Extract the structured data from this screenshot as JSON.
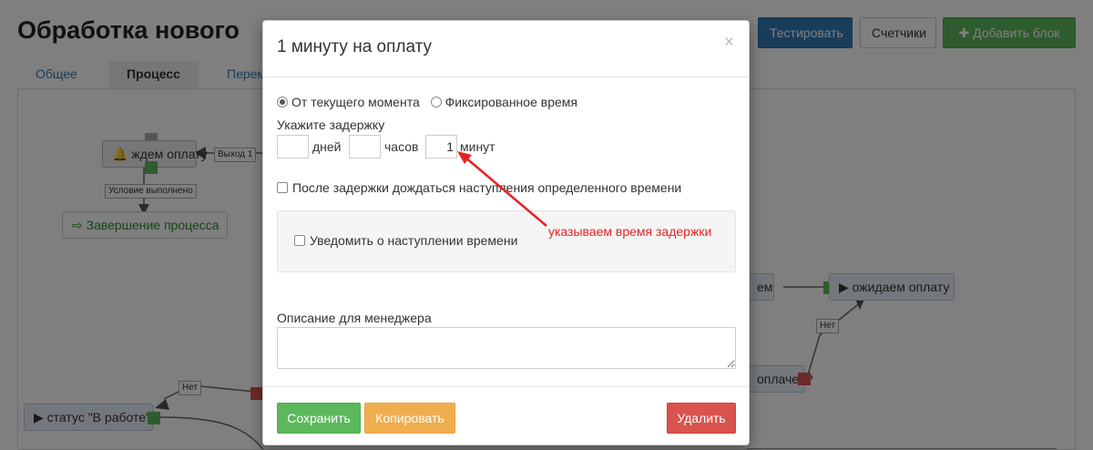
{
  "header": {
    "title": "Обработка нового",
    "buttons": {
      "test": "Тестировать",
      "counters": "Счетчики",
      "add_block": "Добавить блок"
    }
  },
  "tabs": [
    {
      "label": "Общее"
    },
    {
      "label": "Процесс"
    },
    {
      "label": "Перем"
    }
  ],
  "canvas": {
    "nodes": {
      "wait_payment_left": "ждем оплату",
      "finish_process": "Завершение процесса",
      "status_in_work": "статус \"В работе\"",
      "waiting_payment": "ожидаем оплату",
      "partial_em": "ем",
      "paid_question": "оплачен?"
    },
    "labels": {
      "exit1": "Выход 1",
      "condition_met": "Условие выполнено",
      "no_left": "Нет",
      "no_right": "Нет"
    }
  },
  "modal": {
    "title": "1 минуту на оплату",
    "close_symbol": "×",
    "mode_options": {
      "current": "От текущего момента",
      "fixed": "Фиксированное время"
    },
    "delay_label": "Укажите задержку",
    "delay": {
      "days_value": "",
      "days_unit": "дней",
      "hours_value": "",
      "hours_unit": "часов",
      "minutes_value": "1",
      "minutes_unit": "минут"
    },
    "wait_after_delay": "После задержки дождаться наступления определенного времени",
    "notify_time": "Уведомить о наступлении времени",
    "description_label": "Описание для менеджера",
    "description_value": "",
    "footer": {
      "save": "Сохранить",
      "copy": "Копировать",
      "delete": "Удалить"
    }
  },
  "annotation": "указываем время задержки",
  "colors": {
    "primary": "#337ab7",
    "success": "#5cb85c",
    "warning": "#f0ad4e",
    "danger": "#d9534f",
    "annotation": "#e62323"
  }
}
